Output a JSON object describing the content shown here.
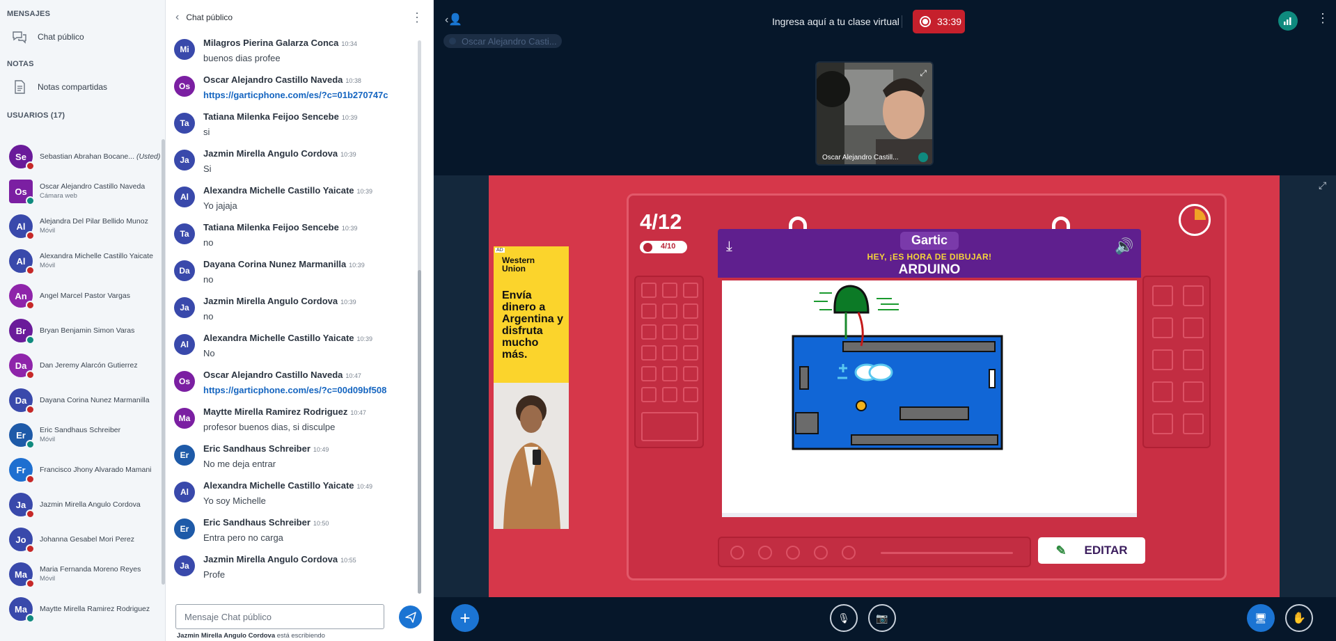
{
  "sidebar": {
    "messages_heading": "MENSAJES",
    "public_chat": "Chat público",
    "notes_heading": "NOTAS",
    "shared_notes": "Notas compartidas",
    "users_heading": "USUARIOS (17)",
    "users": [
      {
        "initials": "Se",
        "name": "Sebastian Abrahan Bocane...",
        "extra": "(Usted)",
        "sub": "",
        "color": "#6a1b9a",
        "badge": "#c62828"
      },
      {
        "initials": "Os",
        "name": "Oscar Alejandro Castillo Naveda",
        "extra": "",
        "sub": "Cámara web",
        "color": "#7b1fa2",
        "badge": "#0f8a7e"
      },
      {
        "initials": "Al",
        "name": "Alejandra Del Pilar Bellido Munoz",
        "extra": "",
        "sub": "Móvil",
        "color": "#3949ab",
        "badge": "#c62828"
      },
      {
        "initials": "Al",
        "name": "Alexandra Michelle Castillo Yaicate",
        "extra": "",
        "sub": "Móvil",
        "color": "#3949ab",
        "badge": "#c62828"
      },
      {
        "initials": "An",
        "name": "Angel Marcel Pastor Vargas",
        "extra": "",
        "sub": "",
        "color": "#8e24aa",
        "badge": "#c62828"
      },
      {
        "initials": "Br",
        "name": "Bryan Benjamin Simon Varas",
        "extra": "",
        "sub": "",
        "color": "#6a1b9a",
        "badge": "#0f8a7e"
      },
      {
        "initials": "Da",
        "name": "Dan Jeremy Alarcón Gutierrez",
        "extra": "",
        "sub": "",
        "color": "#8e24aa",
        "badge": "#c62828"
      },
      {
        "initials": "Da",
        "name": "Dayana Corina Nunez Marmanilla",
        "extra": "",
        "sub": "",
        "color": "#3949ab",
        "badge": "#c62828"
      },
      {
        "initials": "Er",
        "name": "Eric Sandhaus Schreiber",
        "extra": "",
        "sub": "Móvil",
        "color": "#1e5aa8",
        "badge": "#0f8a7e"
      },
      {
        "initials": "Fr",
        "name": "Francisco Jhony Alvarado Mamani",
        "extra": "",
        "sub": "",
        "color": "#1e6fd0",
        "badge": "#c62828"
      },
      {
        "initials": "Ja",
        "name": "Jazmin Mirella Angulo Cordova",
        "extra": "",
        "sub": "",
        "color": "#3949ab",
        "badge": "#c62828"
      },
      {
        "initials": "Jo",
        "name": "Johanna Gesabel Mori Perez",
        "extra": "",
        "sub": "",
        "color": "#3949ab",
        "badge": "#c62828"
      },
      {
        "initials": "Ma",
        "name": "Maria Fernanda Moreno Reyes",
        "extra": "",
        "sub": "Móvil",
        "color": "#3949ab",
        "badge": "#c62828"
      },
      {
        "initials": "Ma",
        "name": "Maytte Mirella Ramirez Rodriguez",
        "extra": "",
        "sub": "",
        "color": "#3949ab",
        "badge": "#0f8a7e"
      }
    ]
  },
  "chat": {
    "title": "Chat público",
    "messages": [
      {
        "initials": "Mi",
        "name": "Milagros Pierina Galarza Conca",
        "time": "10:34",
        "text": "buenos dias profee",
        "link": false,
        "color": "#3949ab"
      },
      {
        "initials": "Os",
        "name": "Oscar Alejandro Castillo Naveda",
        "time": "10:38",
        "text": "https://garticphone.com/es/?c=01b270747c",
        "link": true,
        "color": "#7b1fa2"
      },
      {
        "initials": "Ta",
        "name": "Tatiana Milenka Feijoo Sencebe",
        "time": "10:39",
        "text": "si",
        "link": false,
        "color": "#3949ab"
      },
      {
        "initials": "Ja",
        "name": "Jazmin Mirella Angulo Cordova",
        "time": "10:39",
        "text": "Si",
        "link": false,
        "color": "#3949ab"
      },
      {
        "initials": "Al",
        "name": "Alexandra Michelle Castillo Yaicate",
        "time": "10:39",
        "text": "Yo jajaja",
        "link": false,
        "color": "#3949ab"
      },
      {
        "initials": "Ta",
        "name": "Tatiana Milenka Feijoo Sencebe",
        "time": "10:39",
        "text": "no",
        "link": false,
        "color": "#3949ab"
      },
      {
        "initials": "Da",
        "name": "Dayana Corina Nunez Marmanilla",
        "time": "10:39",
        "text": "no",
        "link": false,
        "color": "#3949ab"
      },
      {
        "initials": "Ja",
        "name": "Jazmin Mirella Angulo Cordova",
        "time": "10:39",
        "text": "no",
        "link": false,
        "color": "#3949ab"
      },
      {
        "initials": "Al",
        "name": "Alexandra Michelle Castillo Yaicate",
        "time": "10:39",
        "text": "No",
        "link": false,
        "color": "#3949ab"
      },
      {
        "initials": "Os",
        "name": "Oscar Alejandro Castillo Naveda",
        "time": "10:47",
        "text": "https://garticphone.com/es/?c=00d09bf508",
        "link": true,
        "color": "#7b1fa2"
      },
      {
        "initials": "Ma",
        "name": "Maytte Mirella Ramirez Rodriguez",
        "time": "10:47",
        "text": "profesor buenos dias, si disculpe",
        "link": false,
        "color": "#7b1fa2"
      },
      {
        "initials": "Er",
        "name": "Eric Sandhaus Schreiber",
        "time": "10:49",
        "text": "No me deja entrar",
        "link": false,
        "color": "#1e5aa8"
      },
      {
        "initials": "Al",
        "name": "Alexandra Michelle Castillo Yaicate",
        "time": "10:49",
        "text": "Yo soy Michelle",
        "link": false,
        "color": "#3949ab"
      },
      {
        "initials": "Er",
        "name": "Eric Sandhaus Schreiber",
        "time": "10:50",
        "text": "Entra pero no carga",
        "link": false,
        "color": "#1e5aa8"
      },
      {
        "initials": "Ja",
        "name": "Jazmin Mirella Angulo Cordova",
        "time": "10:55",
        "text": "Profe",
        "link": false,
        "color": "#3949ab"
      }
    ],
    "input_placeholder": "Mensaje Chat público",
    "typing_user": "Jazmin Mirella Angulo Cordova",
    "typing_suffix": "está escribiendo"
  },
  "topbar": {
    "title": "Ingresa aquí a tu clase virtual",
    "recording_time": "33:39",
    "talking_user": "Oscar Alejandro Casti..."
  },
  "webcam": {
    "label": "Oscar Alejandro Castill..."
  },
  "game": {
    "round": "4/12",
    "done": "4/10",
    "logo": "Gartic",
    "prompt_label": "HEY, ¡ES HORA DE DIBUJAR!",
    "word": "ARDUINO",
    "edit_button": "EDITAR",
    "ad_tag": "AD",
    "ad_brand": "Western Union",
    "ad_copy": "Envía dinero a Argentina y disfruta mucho más."
  },
  "colors": {
    "accent": "#1b74d3",
    "record": "#c6202c",
    "slide_bg": "#d6374a",
    "gartic_purple": "#5f1f8e"
  }
}
